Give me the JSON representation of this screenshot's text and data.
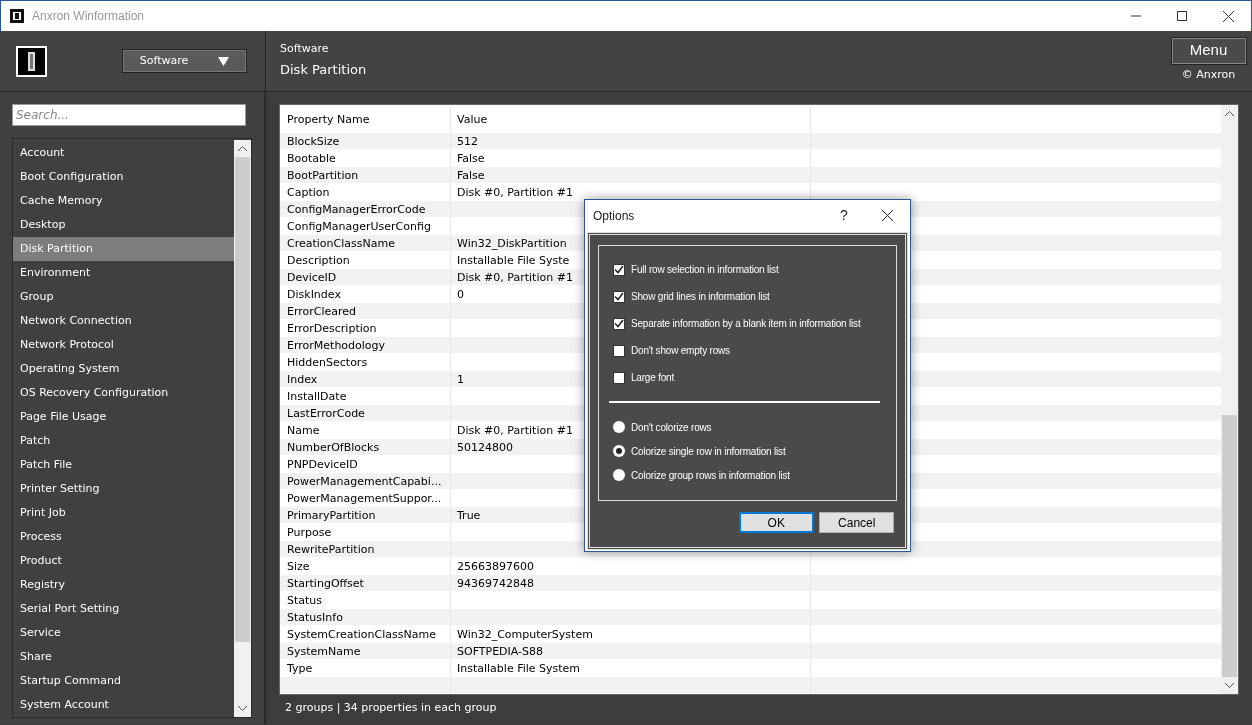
{
  "window": {
    "title": "Anxron Winformation"
  },
  "header": {
    "category_button": "Software",
    "breadcrumb": [
      "Software",
      "Disk Partition"
    ],
    "menu_button": "Menu",
    "copyright": "© Anxron"
  },
  "sidebar": {
    "search_placeholder": "Search...",
    "items": [
      {
        "label": "Account",
        "selected": false
      },
      {
        "label": "Boot Configuration",
        "selected": false
      },
      {
        "label": "Cache Memory",
        "selected": false
      },
      {
        "label": "Desktop",
        "selected": false
      },
      {
        "label": "Disk Partition",
        "selected": true
      },
      {
        "label": "Environment",
        "selected": false
      },
      {
        "label": "Group",
        "selected": false
      },
      {
        "label": "Network Connection",
        "selected": false
      },
      {
        "label": "Network Protocol",
        "selected": false
      },
      {
        "label": "Operating System",
        "selected": false
      },
      {
        "label": "OS Recovery Configuration",
        "selected": false
      },
      {
        "label": "Page File Usage",
        "selected": false
      },
      {
        "label": "Patch",
        "selected": false
      },
      {
        "label": "Patch File",
        "selected": false
      },
      {
        "label": "Printer Setting",
        "selected": false
      },
      {
        "label": "Print Job",
        "selected": false
      },
      {
        "label": "Process",
        "selected": false
      },
      {
        "label": "Product",
        "selected": false
      },
      {
        "label": "Registry",
        "selected": false
      },
      {
        "label": "Serial Port Setting",
        "selected": false
      },
      {
        "label": "Service",
        "selected": false
      },
      {
        "label": "Share",
        "selected": false
      },
      {
        "label": "Startup Command",
        "selected": false
      },
      {
        "label": "System Account",
        "selected": false
      }
    ]
  },
  "table": {
    "columns": [
      "Property Name",
      "Value"
    ],
    "rows": [
      [
        "BlockSize",
        "512"
      ],
      [
        "Bootable",
        "False"
      ],
      [
        "BootPartition",
        "False"
      ],
      [
        "Caption",
        "Disk #0, Partition #1"
      ],
      [
        "ConfigManagerErrorCode",
        ""
      ],
      [
        "ConfigManagerUserConfig",
        ""
      ],
      [
        "CreationClassName",
        "Win32_DiskPartition"
      ],
      [
        "Description",
        "Installable File Syste"
      ],
      [
        "DeviceID",
        "Disk #0, Partition #1"
      ],
      [
        "DiskIndex",
        "0"
      ],
      [
        "ErrorCleared",
        ""
      ],
      [
        "ErrorDescription",
        ""
      ],
      [
        "ErrorMethodology",
        ""
      ],
      [
        "HiddenSectors",
        ""
      ],
      [
        "Index",
        "1"
      ],
      [
        "InstallDate",
        ""
      ],
      [
        "LastErrorCode",
        ""
      ],
      [
        "Name",
        "Disk #0, Partition #1"
      ],
      [
        "NumberOfBlocks",
        "50124800"
      ],
      [
        "PNPDeviceID",
        ""
      ],
      [
        "PowerManagementCapabi...",
        ""
      ],
      [
        "PowerManagementSuppor...",
        ""
      ],
      [
        "PrimaryPartition",
        "True"
      ],
      [
        "Purpose",
        ""
      ],
      [
        "RewritePartition",
        ""
      ],
      [
        "Size",
        "25663897600"
      ],
      [
        "StartingOffset",
        "94369742848"
      ],
      [
        "Status",
        ""
      ],
      [
        "StatusInfo",
        ""
      ],
      [
        "SystemCreationClassName",
        "Win32_ComputerSystem"
      ],
      [
        "SystemName",
        "SOFTPEDIA-S88"
      ],
      [
        "Type",
        "Installable File System"
      ]
    ]
  },
  "status_bar": "2 groups | 34 properties in each group",
  "dialog": {
    "title": "Options",
    "help": "?",
    "options": [
      {
        "kind": "checkbox",
        "label": "Full row selection in information list",
        "checked": true
      },
      {
        "kind": "checkbox",
        "label": "Show grid lines in information list",
        "checked": true
      },
      {
        "kind": "checkbox",
        "label": "Separate information by a blank item in information list",
        "checked": true
      },
      {
        "kind": "checkbox",
        "label": "Don't show empty rows",
        "checked": false
      },
      {
        "kind": "checkbox",
        "label": "Large font",
        "checked": false
      },
      {
        "kind": "separator"
      },
      {
        "kind": "radio",
        "label": "Don't colorize rows",
        "selected": false
      },
      {
        "kind": "radio",
        "label": "Colorize single row in information list",
        "selected": true
      },
      {
        "kind": "radio",
        "label": "Colorize group rows in information list",
        "selected": false
      }
    ],
    "buttons": [
      {
        "label": "OK",
        "default": true
      },
      {
        "label": "Cancel",
        "default": false
      }
    ]
  }
}
